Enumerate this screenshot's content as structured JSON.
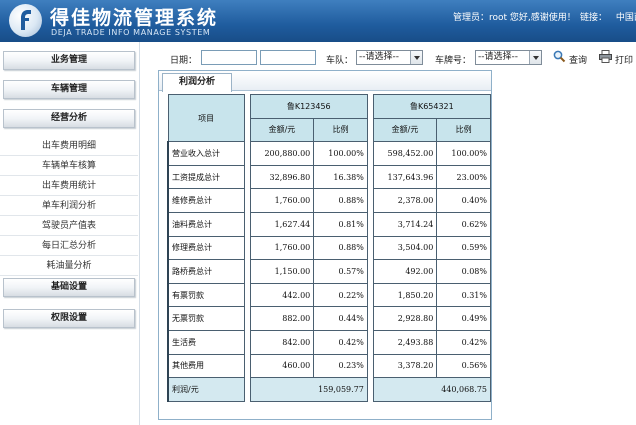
{
  "header": {
    "title": "得佳物流管理系统",
    "subtitle": "DEJA TRADE INFO MANAGE SYSTEM",
    "user_info": "管理员：root 您好,感谢使用！",
    "link_label": "链接：",
    "link_home": "中国西"
  },
  "sidebar": {
    "menus": [
      {
        "label": "业务管理"
      },
      {
        "label": "车辆管理"
      },
      {
        "label": "经营分析"
      }
    ],
    "sub_items": [
      {
        "label": "出车费用明细"
      },
      {
        "label": "车辆单车核算"
      },
      {
        "label": "出车费用统计"
      },
      {
        "label": "单车利润分析"
      },
      {
        "label": "驾驶员产值表"
      },
      {
        "label": "每日汇总分析"
      },
      {
        "label": "耗油量分析"
      }
    ],
    "bottom_menus": [
      {
        "label": "基础设置"
      },
      {
        "label": "权限设置"
      }
    ]
  },
  "search": {
    "date_label": "日期：",
    "date_from": "",
    "date_to": "",
    "team_label": "车队：",
    "team_select": "--请选择--",
    "plate_label": "车牌号：",
    "plate_select": "--请选择--",
    "search_label": "查询",
    "print_label": "打印"
  },
  "panel": {
    "tab_label": "利润分析",
    "col_item": "项目",
    "col_amount": "金额/元",
    "col_ratio": "比例",
    "vehicles": [
      {
        "plate": "鲁K123456"
      },
      {
        "plate": "鲁K654321"
      }
    ],
    "rows": [
      {
        "item": "营业收入总计",
        "a1": "200,880.00",
        "r1": "100.00%",
        "a2": "598,452.00",
        "r2": "100.00%"
      },
      {
        "item": "工资提成总计",
        "a1": "32,896.80",
        "r1": "16.38%",
        "a2": "137,643.96",
        "r2": "23.00%"
      },
      {
        "item": "维修费总计",
        "a1": "1,760.00",
        "r1": "0.88%",
        "a2": "2,378.00",
        "r2": "0.40%"
      },
      {
        "item": "油料费总计",
        "a1": "1,627.44",
        "r1": "0.81%",
        "a2": "3,714.24",
        "r2": "0.62%"
      },
      {
        "item": "修理费总计",
        "a1": "1,760.00",
        "r1": "0.88%",
        "a2": "3,504.00",
        "r2": "0.59%"
      },
      {
        "item": "路桥费总计",
        "a1": "1,150.00",
        "r1": "0.57%",
        "a2": "492.00",
        "r2": "0.08%"
      },
      {
        "item": "有票罚款",
        "a1": "442.00",
        "r1": "0.22%",
        "a2": "1,850.20",
        "r2": "0.31%"
      },
      {
        "item": "无票罚款",
        "a1": "882.00",
        "r1": "0.44%",
        "a2": "2,928.80",
        "r2": "0.49%"
      },
      {
        "item": "生活费",
        "a1": "842.00",
        "r1": "0.42%",
        "a2": "2,493.88",
        "r2": "0.42%"
      },
      {
        "item": "其他费用",
        "a1": "460.00",
        "r1": "0.23%",
        "a2": "3,378.20",
        "r2": "0.56%"
      }
    ],
    "total": {
      "item": "利润/元",
      "v1": "159,059.77",
      "v2": "440,068.75"
    }
  },
  "colors": {
    "header_bg": "#1f5c9e",
    "table_header_bg": "#c8e4ec",
    "total_bg": "#d4e9f0"
  }
}
